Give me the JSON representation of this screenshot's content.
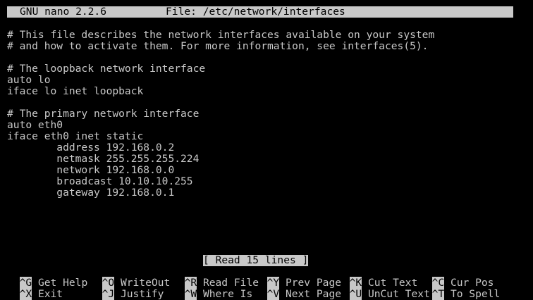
{
  "title_bar": {
    "app_version": "GNU nano 2.2.6",
    "file_label": "File: /etc/network/interfaces"
  },
  "buffer": {
    "lines": [
      "# This file describes the network interfaces available on your system",
      "# and how to activate them. For more information, see interfaces(5).",
      "",
      "# The loopback network interface",
      "auto lo",
      "iface lo inet loopback",
      "",
      "# The primary network interface",
      "auto eth0",
      "iface eth0 inet static",
      "        address 192.168.0.2",
      "        netmask 255.255.255.224",
      "        network 192.168.0.0",
      "        broadcast 10.10.10.255",
      "        gateway 192.168.0.1"
    ]
  },
  "status": {
    "message": "[ Read 15 lines ]"
  },
  "shortcuts": [
    {
      "key": "^G",
      "label": "Get Help"
    },
    {
      "key": "^O",
      "label": "WriteOut"
    },
    {
      "key": "^R",
      "label": "Read File"
    },
    {
      "key": "^Y",
      "label": "Prev Page"
    },
    {
      "key": "^K",
      "label": "Cut Text"
    },
    {
      "key": "^C",
      "label": "Cur Pos"
    },
    {
      "key": "^X",
      "label": "Exit"
    },
    {
      "key": "^J",
      "label": "Justify"
    },
    {
      "key": "^W",
      "label": "Where Is"
    },
    {
      "key": "^V",
      "label": "Next Page"
    },
    {
      "key": "^U",
      "label": "UnCut Text"
    },
    {
      "key": "^T",
      "label": "To Spell"
    }
  ],
  "colors": {
    "background": "#000000",
    "foreground": "#c8c8c8",
    "inverse_text": "#000000"
  }
}
